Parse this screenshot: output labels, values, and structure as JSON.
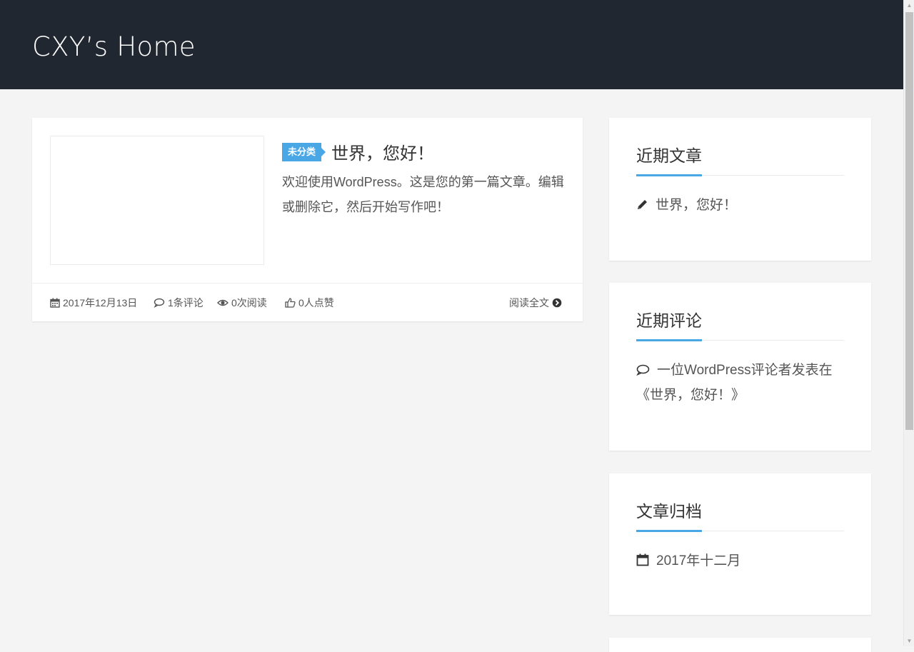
{
  "header": {
    "site_title": "CXY’s Home"
  },
  "post": {
    "category": "未分类",
    "title": "世界，您好！",
    "excerpt": "欢迎使用WordPress。这是您的第一篇文章。编辑或删除它，然后开始写作吧！",
    "meta": {
      "date": "2017年12月13日",
      "comments": "1条评论",
      "views": "0次阅读",
      "likes": "0人点赞",
      "read_more": "阅读全文"
    }
  },
  "sidebar": {
    "recent_posts": {
      "title": "近期文章",
      "items": [
        "世界，您好！"
      ]
    },
    "recent_comments": {
      "title": "近期评论",
      "items": [
        "一位WordPress评论者发表在《世界，您好！》"
      ]
    },
    "archives": {
      "title": "文章归档",
      "items": [
        "2017年十二月"
      ]
    }
  },
  "colors": {
    "header_bg": "#212730",
    "accent": "#4aa7e6",
    "page_bg": "#f4f4f4"
  }
}
